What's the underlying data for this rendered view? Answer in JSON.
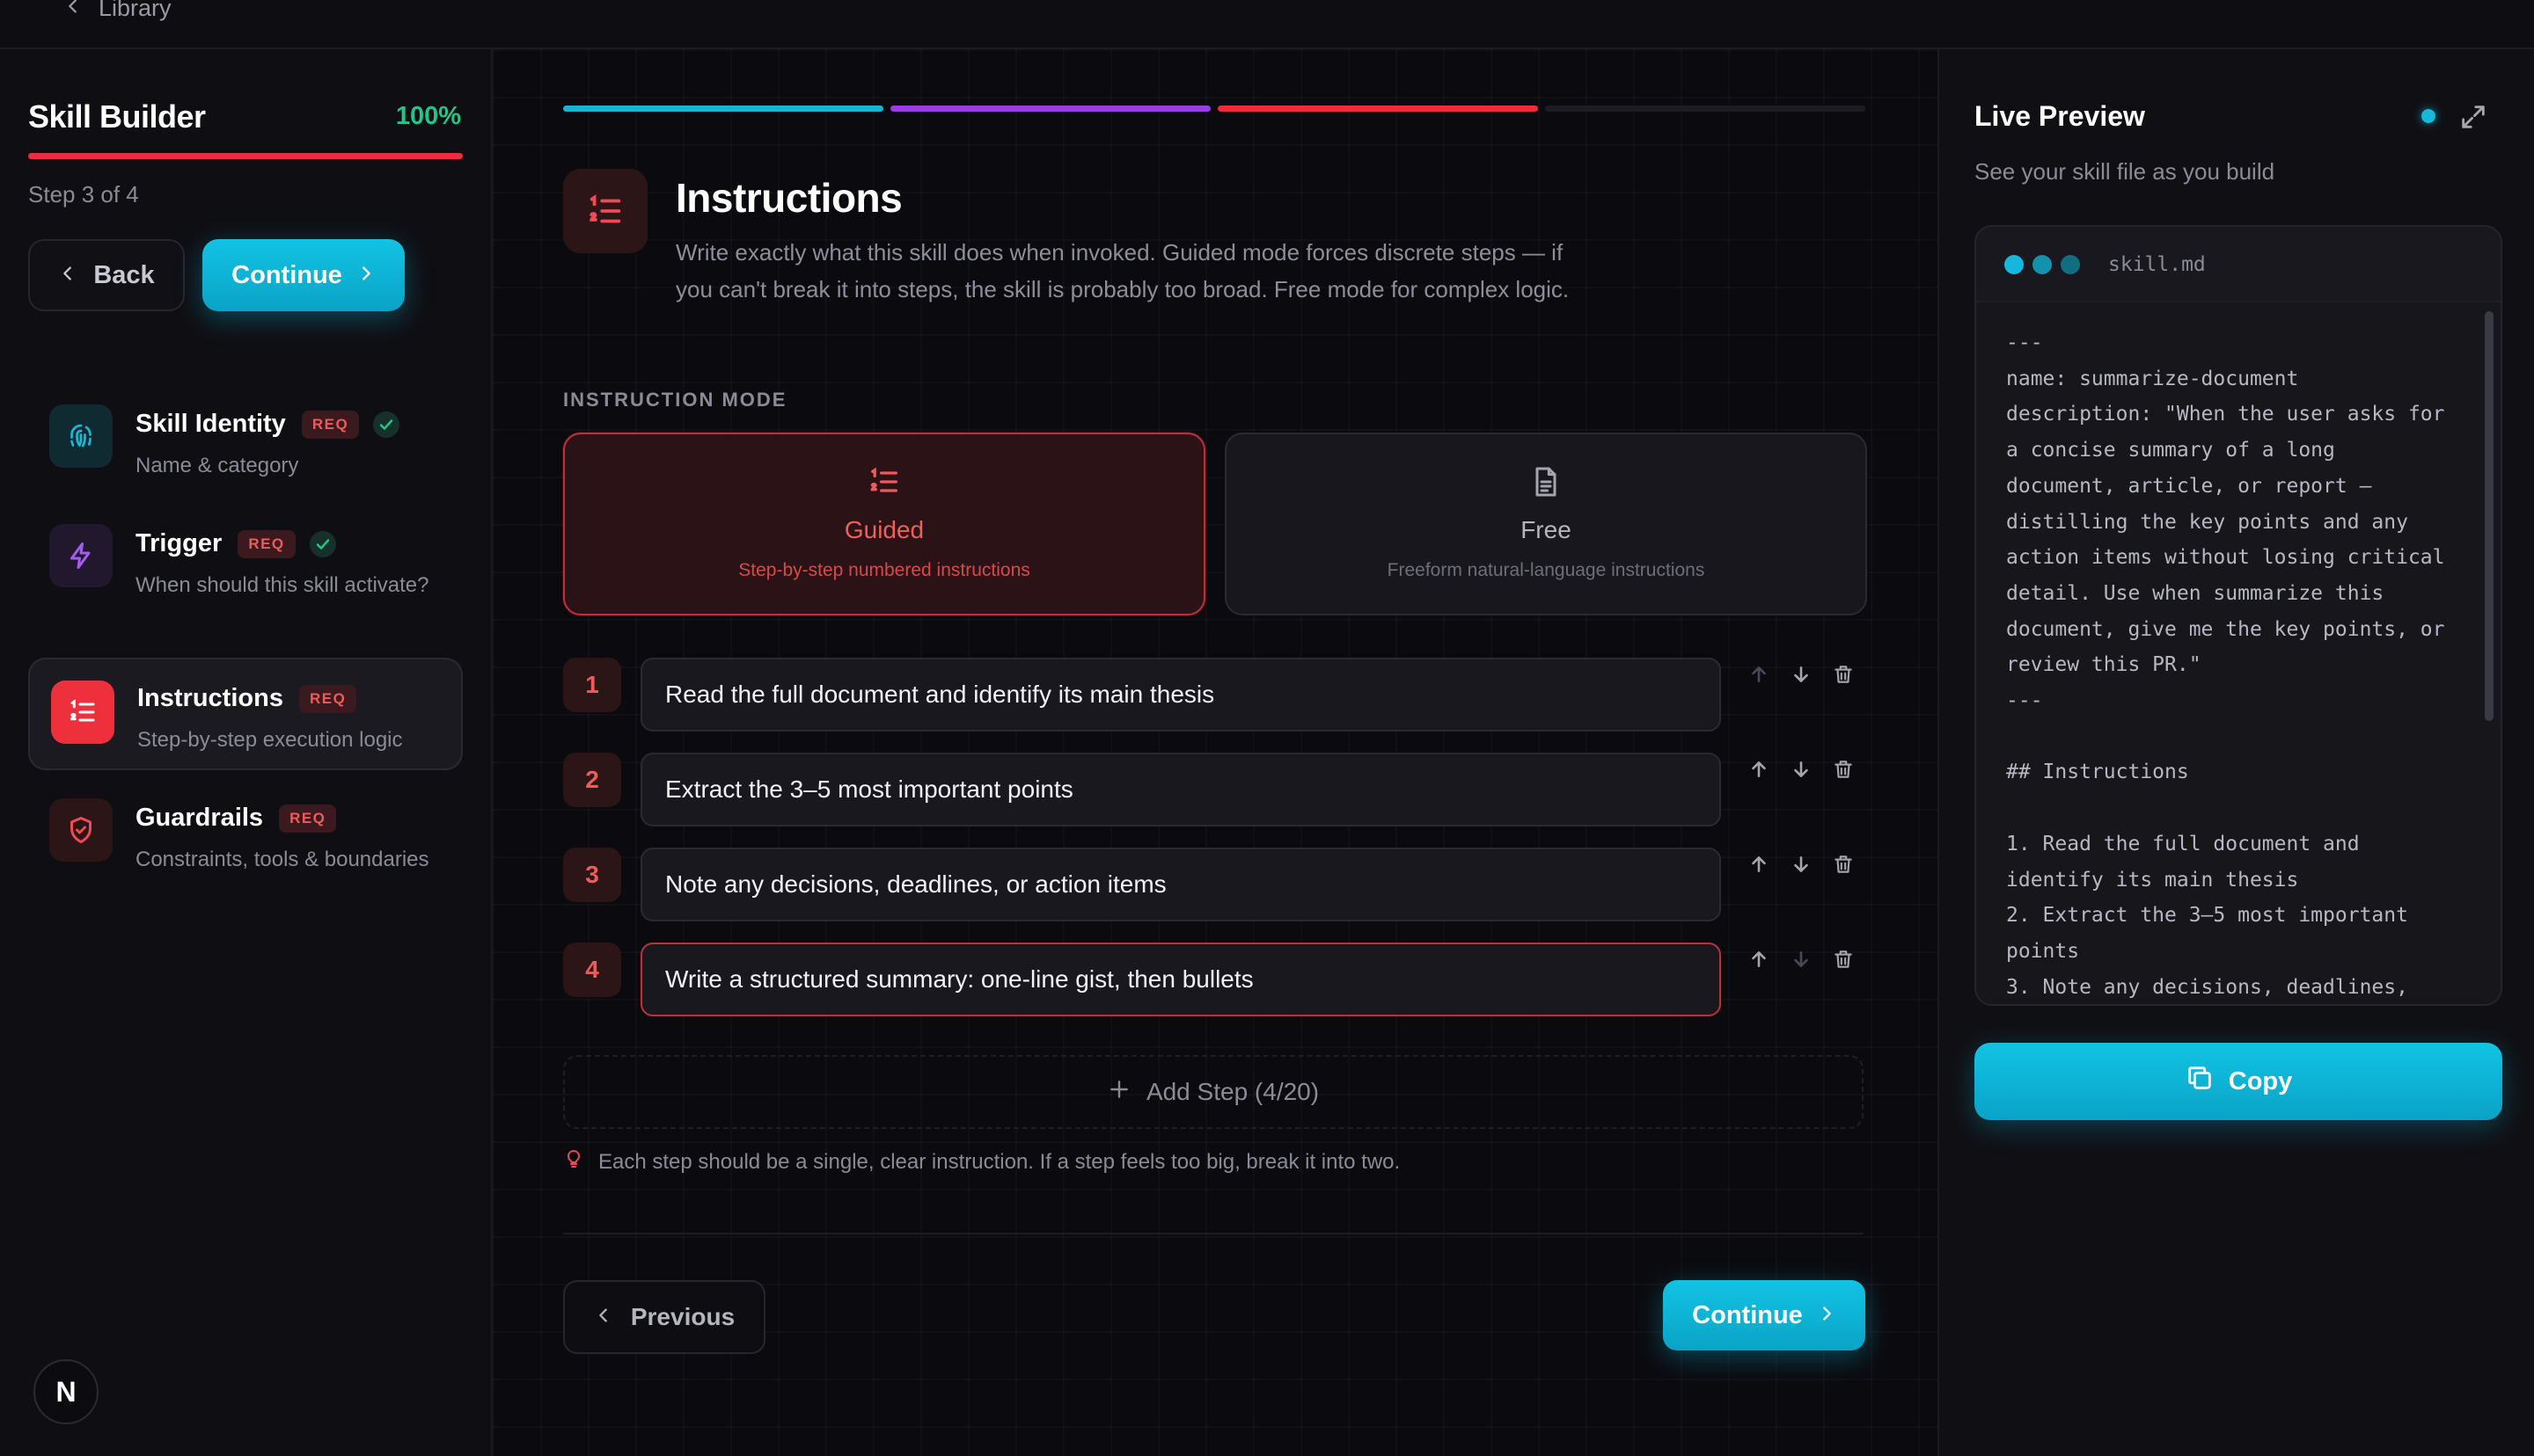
{
  "topbar": {
    "back_label": "Library"
  },
  "sidebar": {
    "title": "Skill Builder",
    "progress_label": "100%",
    "progress": 1.0,
    "step_label": "Step 3 of 4",
    "back_label": "Back",
    "continue_label": "Continue",
    "items": [
      {
        "name": "Skill Identity",
        "badge": "REQ",
        "sub": "Name & category",
        "done": true
      },
      {
        "name": "Trigger",
        "badge": "REQ",
        "sub": "When should this skill activate?",
        "done": true
      },
      {
        "name": "Instructions",
        "badge": "REQ",
        "sub": "Step-by-step execution logic",
        "active": true
      },
      {
        "name": "Guardrails",
        "badge": "REQ",
        "sub": "Constraints, tools & boundaries"
      }
    ],
    "logo_letter": "N"
  },
  "main": {
    "progress_colors": [
      "#16b6d3",
      "#9b3bea",
      "#ef2d3a",
      "#1c1c22"
    ],
    "title": "Instructions",
    "description": "Write exactly what this skill does when invoked. Guided mode forces discrete steps — if you can't break it into steps, the skill is probably too broad. Free mode for complex logic.",
    "mode_label": "INSTRUCTION MODE",
    "modes": {
      "guided": {
        "title": "Guided",
        "sub": "Step-by-step numbered instructions"
      },
      "free": {
        "title": "Free",
        "sub": "Freeform natural-language instructions"
      }
    },
    "steps": [
      {
        "num": "1",
        "text": "Read the full document and identify its main thesis"
      },
      {
        "num": "2",
        "text": "Extract the 3–5 most important points"
      },
      {
        "num": "3",
        "text": "Note any decisions, deadlines, or action items"
      },
      {
        "num": "4",
        "text": "Write a structured summary: one-line gist, then bullets"
      }
    ],
    "add_step_label": "Add Step (4/20)",
    "tip": "Each step should be a single, clear instruction. If a step feels too big, break it into two.",
    "previous_label": "Previous",
    "continue_label": "Continue"
  },
  "preview": {
    "title": "Live Preview",
    "subtitle": "See your skill file as you build",
    "file_name": "skill.md",
    "content": "---\nname: summarize-document\ndescription: \"When the user asks for a concise summary of a long document, article, or report — distilling the key points and any action items without losing critical detail. Use when summarize this document, give me the key points, or review this PR.\"\n---\n\n## Instructions\n\n1. Read the full document and identify its main thesis\n2. Extract the 3–5 most important points\n3. Note any decisions, deadlines,",
    "copy_label": "Copy",
    "accent": "#15b8dc"
  }
}
